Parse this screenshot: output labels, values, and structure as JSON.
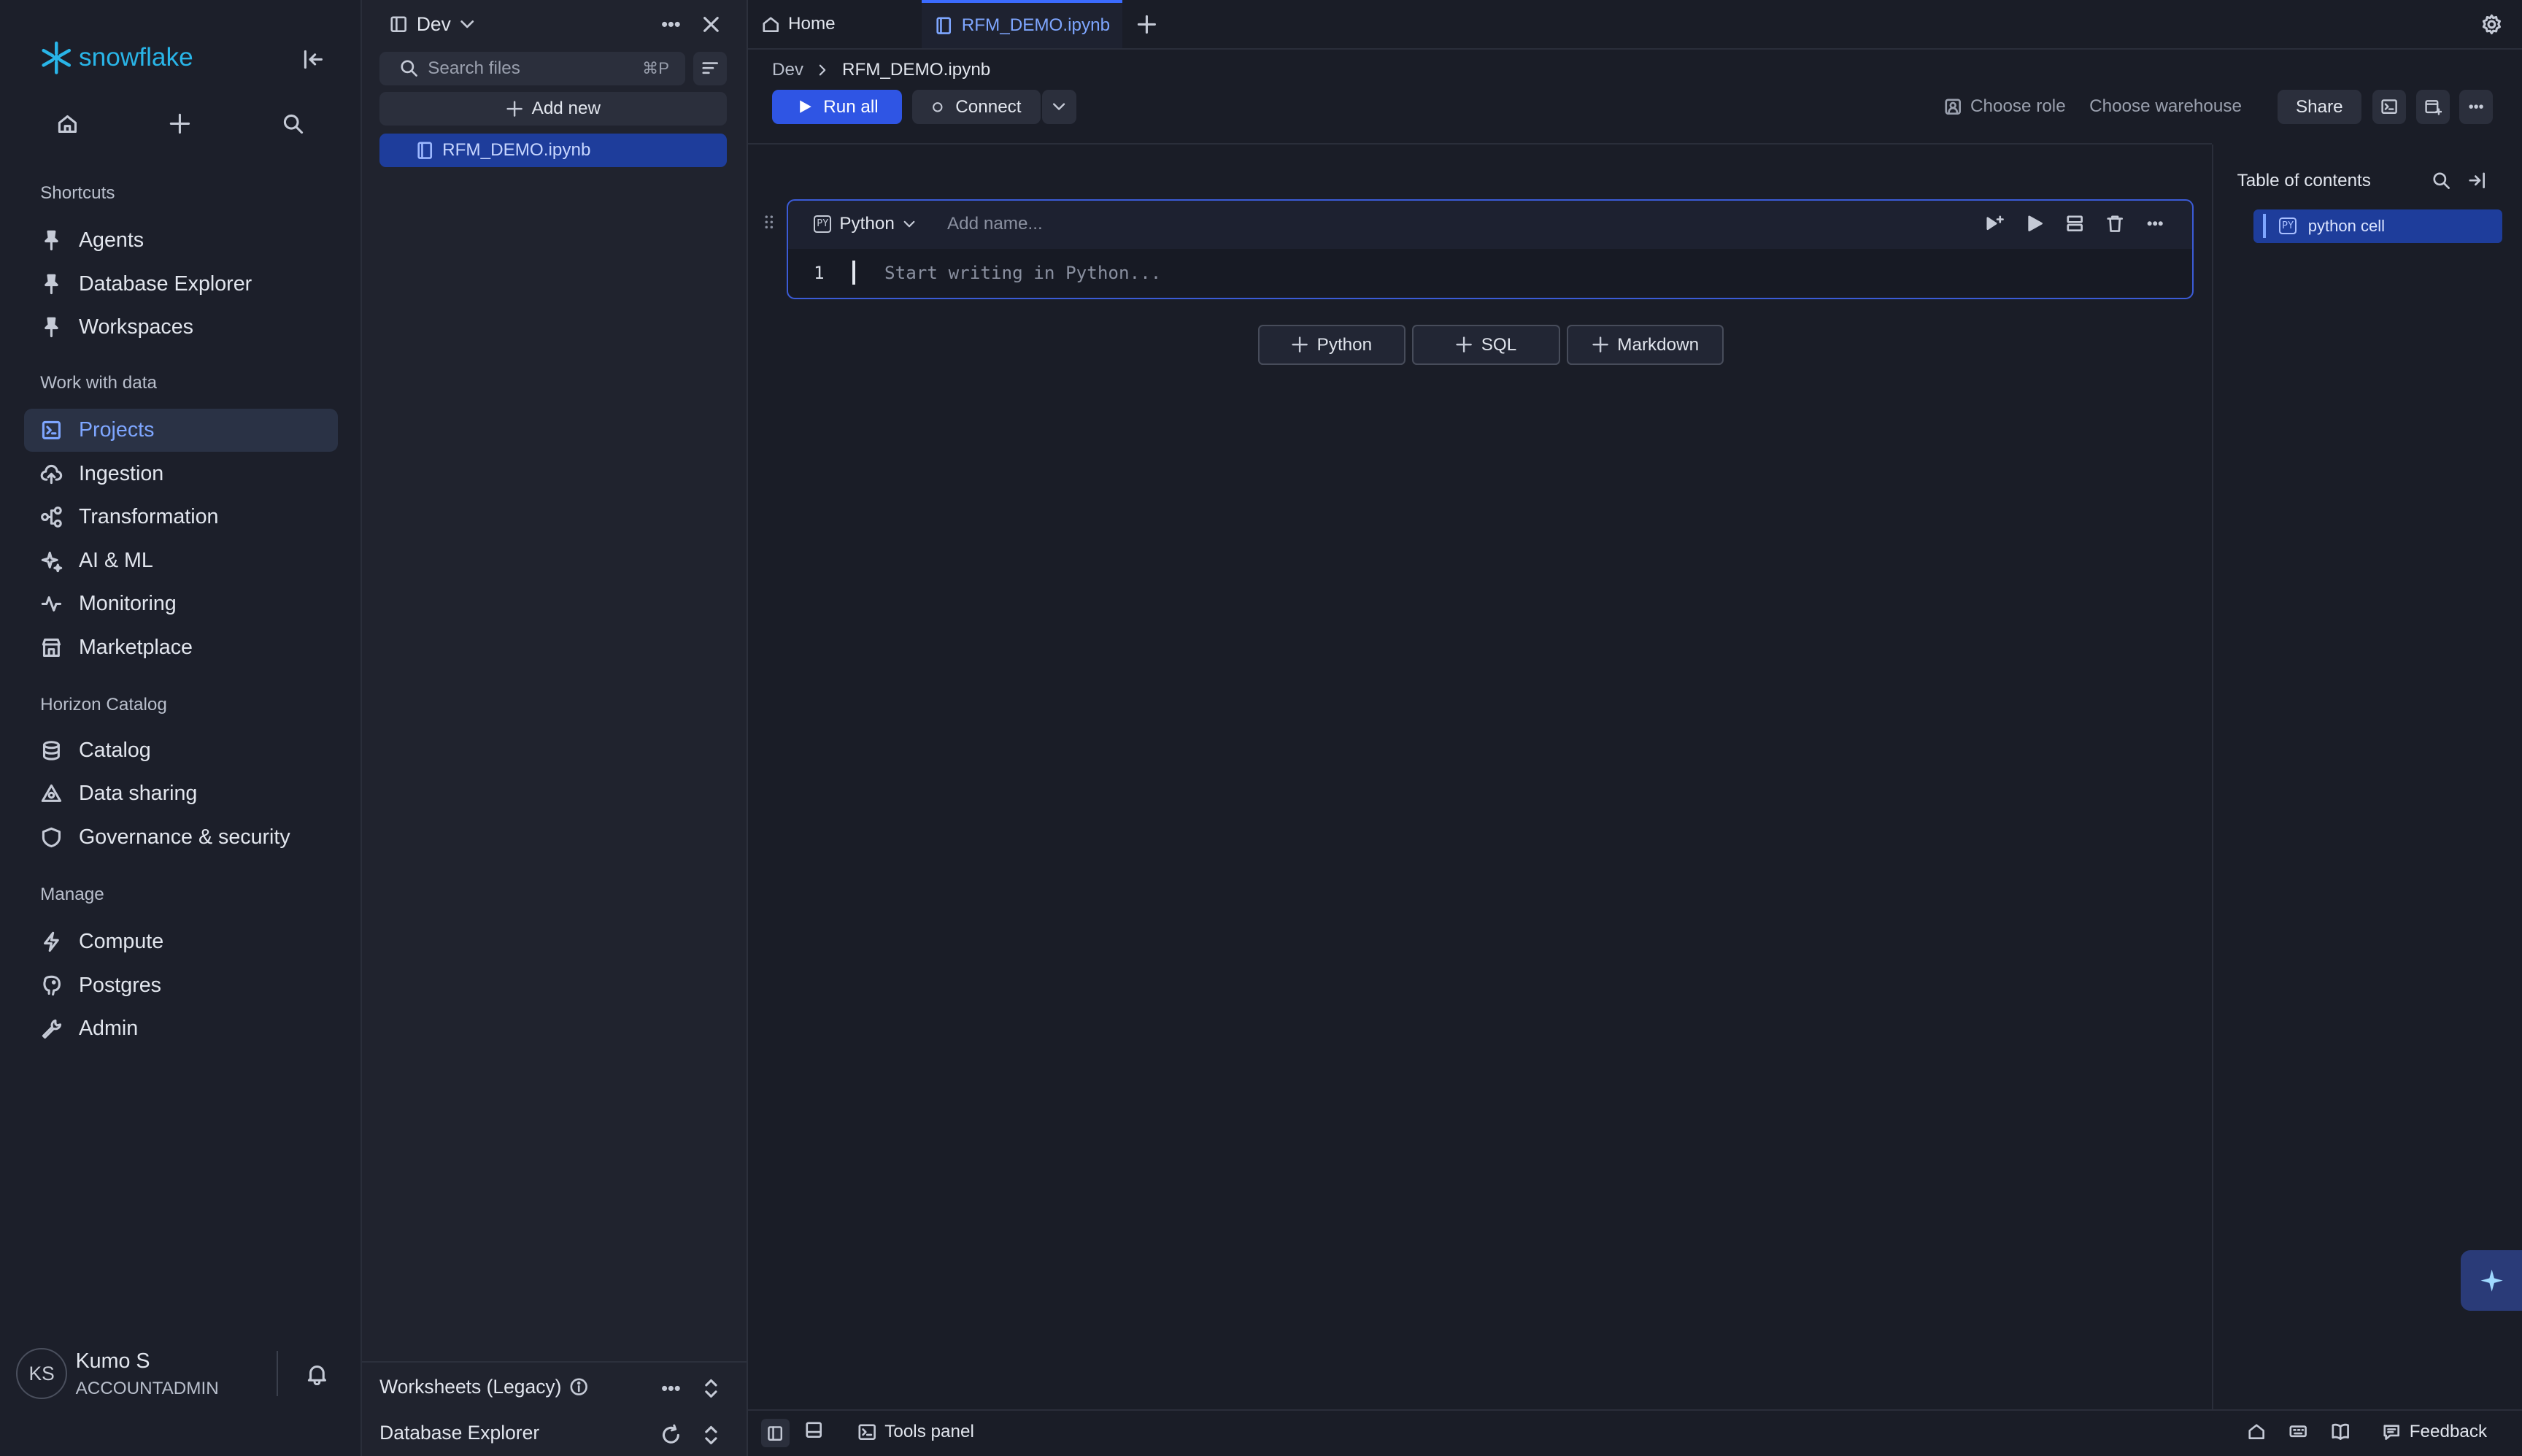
{
  "brand": {
    "name": "snowflake",
    "color": "#29b5e8"
  },
  "nav": {
    "sections": {
      "shortcuts": "Shortcuts",
      "work": "Work with data",
      "horizon": "Horizon Catalog",
      "manage": "Manage"
    },
    "shortcuts": [
      {
        "label": "Agents",
        "icon": "pin-icon"
      },
      {
        "label": "Database Explorer",
        "icon": "pin-icon"
      },
      {
        "label": "Workspaces",
        "icon": "pin-icon"
      }
    ],
    "work": [
      {
        "label": "Projects",
        "icon": "projects-icon",
        "active": true
      },
      {
        "label": "Ingestion",
        "icon": "cloud-upload-icon"
      },
      {
        "label": "Transformation",
        "icon": "flow-icon"
      },
      {
        "label": "AI & ML",
        "icon": "sparkle-icon"
      },
      {
        "label": "Monitoring",
        "icon": "activity-icon"
      },
      {
        "label": "Marketplace",
        "icon": "store-icon"
      }
    ],
    "horizon": [
      {
        "label": "Catalog",
        "icon": "database-icon"
      },
      {
        "label": "Data sharing",
        "icon": "share-icon"
      },
      {
        "label": "Governance & security",
        "icon": "shield-icon"
      }
    ],
    "manage": [
      {
        "label": "Compute",
        "icon": "bolt-icon"
      },
      {
        "label": "Postgres",
        "icon": "postgres-icon"
      },
      {
        "label": "Admin",
        "icon": "wrench-icon"
      }
    ],
    "user": {
      "initials": "KS",
      "name": "Kumo S",
      "role": "ACCOUNTADMIN"
    }
  },
  "files": {
    "workspace": "Dev",
    "search_placeholder": "Search files",
    "search_shortcut": "⌘P",
    "add_new": "Add new",
    "items": [
      {
        "name": "RFM_DEMO.ipynb",
        "selected": true
      }
    ],
    "bottom": {
      "worksheets": "Worksheets (Legacy)",
      "db_explorer": "Database Explorer"
    }
  },
  "tabs": [
    {
      "label": "Home",
      "icon": "home-icon",
      "active": false
    },
    {
      "label": "RFM_DEMO.ipynb",
      "icon": "notebook-icon",
      "active": true
    }
  ],
  "breadcrumb": [
    "Dev",
    "RFM_DEMO.ipynb"
  ],
  "toolbar": {
    "run_all": "Run all",
    "connect": "Connect",
    "choose_role": "Choose role",
    "choose_warehouse": "Choose warehouse",
    "share": "Share"
  },
  "cell": {
    "language": "Python",
    "lang_badge": "PY",
    "name_placeholder": "Add name...",
    "line_number": "1",
    "code_placeholder": "Start writing in Python..."
  },
  "add_cell": {
    "python": "Python",
    "sql": "SQL",
    "markdown": "Markdown"
  },
  "toc": {
    "title": "Table of contents",
    "items": [
      {
        "badge": "PY",
        "label": "python cell"
      }
    ]
  },
  "statusbar": {
    "tools_panel": "Tools panel",
    "feedback": "Feedback"
  },
  "colors": {
    "accent": "#2f55e4",
    "active_text": "#7ea6ff",
    "background": "#1a1d27"
  }
}
